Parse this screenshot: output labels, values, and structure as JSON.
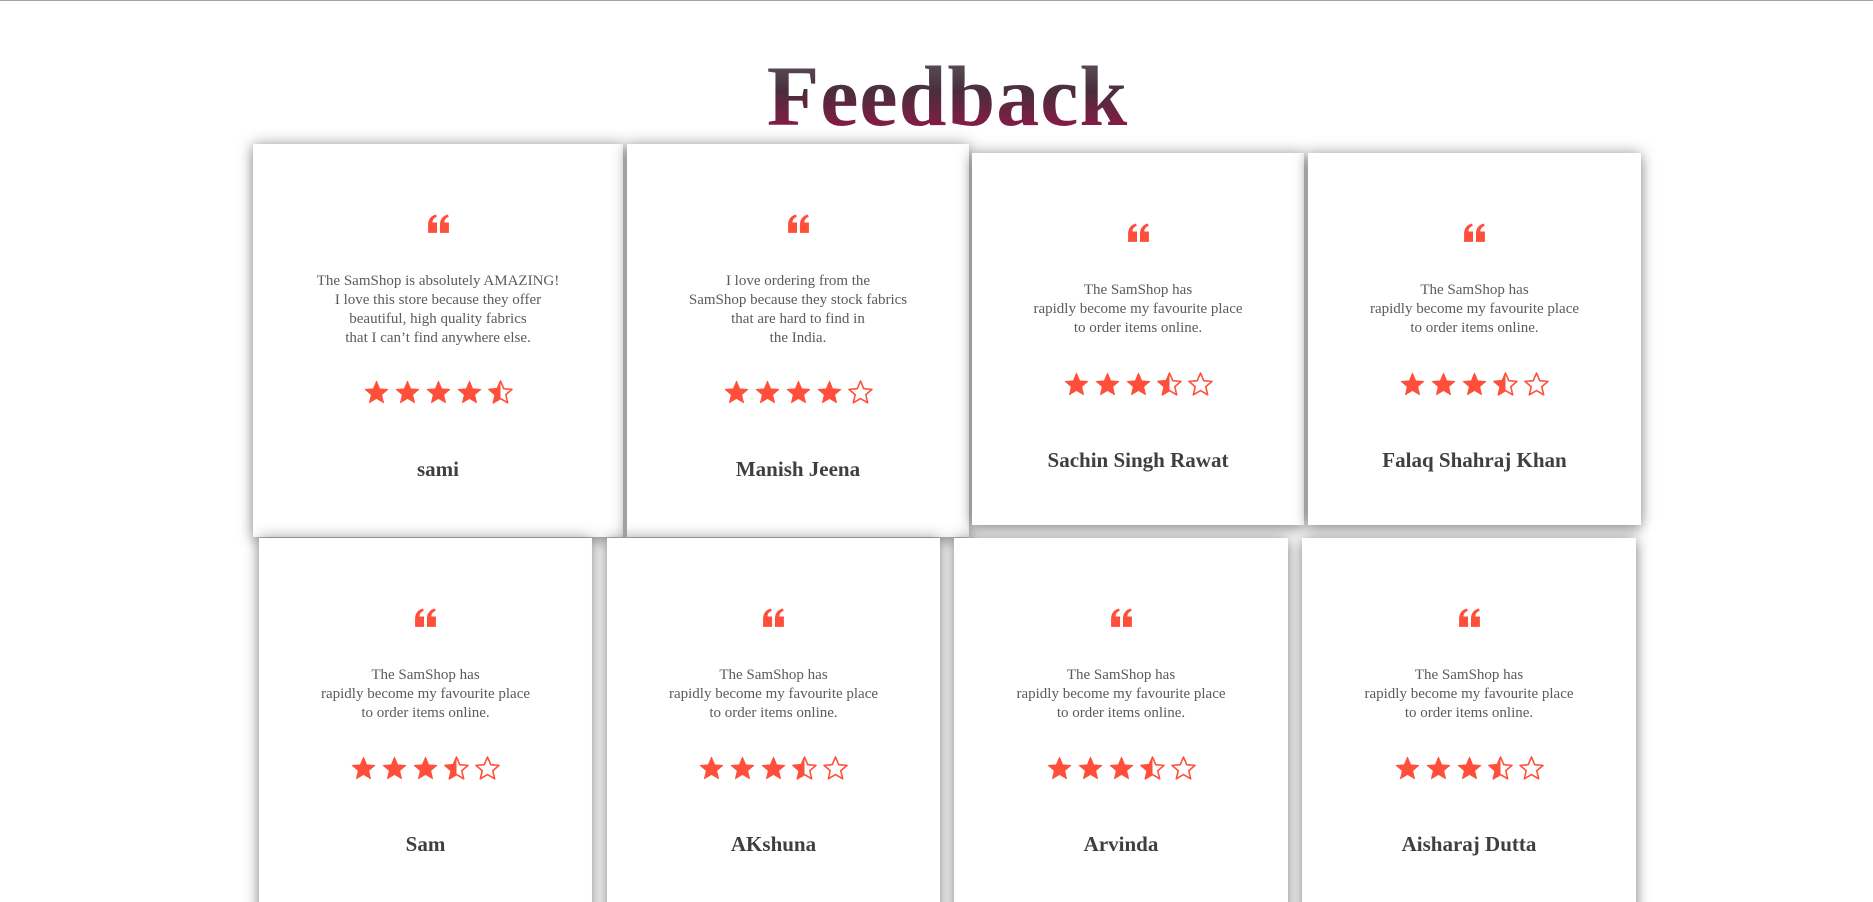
{
  "title": "Feedback",
  "colors": {
    "accent": "#ff4f3a",
    "title_gradient_top": "#5f5f63",
    "title_gradient_bottom": "#a3134a",
    "review_text": "#5b5b5b",
    "name_text": "#3f3f3f"
  },
  "reviews": [
    {
      "text": "The SamShop is absolutely AMAZING!\nI love this store because they offer\nbeautiful, high quality fabrics\nthat I can’t find anywhere else.",
      "rating": 4.5,
      "name": "sami"
    },
    {
      "text": "I love ordering from the\nSamShop because they stock fabrics\nthat are hard to find in\nthe India.",
      "rating": 4,
      "name": "Manish Jeena"
    },
    {
      "text": "The SamShop has\nrapidly become my favourite place\nto order items online.",
      "rating": 3.5,
      "name": "Sachin Singh Rawat"
    },
    {
      "text": "The SamShop has\nrapidly become my favourite place\nto order items online.",
      "rating": 3.5,
      "name": "Falaq Shahraj Khan"
    },
    {
      "text": "The SamShop has\nrapidly become my favourite place\nto order items online.",
      "rating": 3.5,
      "name": "Sam"
    },
    {
      "text": "The SamShop has\nrapidly become my favourite place\nto order items online.",
      "rating": 3.5,
      "name": "AKshuna"
    },
    {
      "text": "The SamShop has\nrapidly become my favourite place\nto order items online.",
      "rating": 3.5,
      "name": "Arvinda"
    },
    {
      "text": "The SamShop has\nrapidly become my favourite place\nto order items online.",
      "rating": 3.5,
      "name": "Aisharaj Dutta"
    }
  ]
}
